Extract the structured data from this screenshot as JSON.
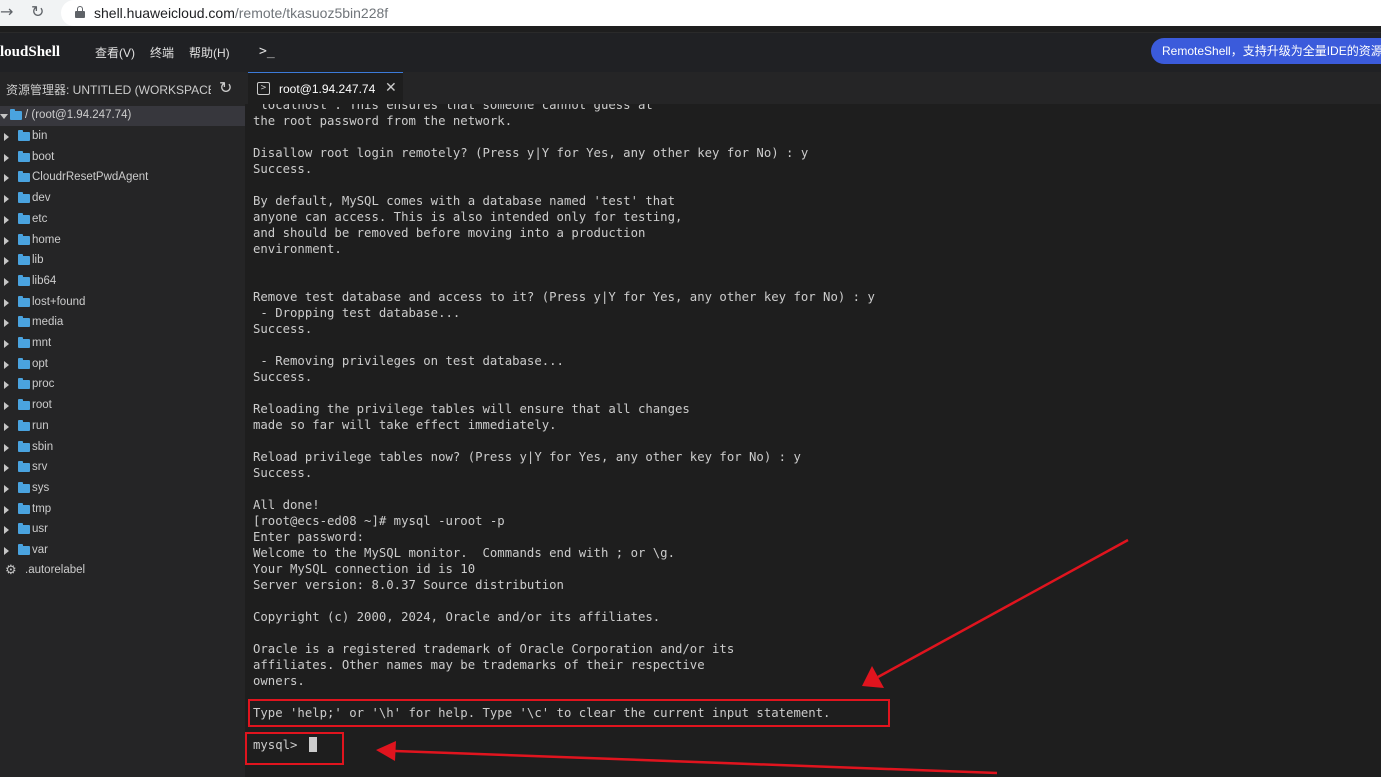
{
  "browser": {
    "url_host": "shell.huaweicloud.com",
    "url_path": "/remote/tkasuoz5bin228f"
  },
  "app": {
    "title": "loudShell",
    "menu": [
      "查看(V)",
      "终端",
      "帮助(H)"
    ],
    "promo_text": "RemoteShell，支持升级为全量IDE的资源管理"
  },
  "sidebar": {
    "title": "资源管理器: UNTITLED (WORKSPACE)",
    "root_label": "/ (root@1.94.247.74)",
    "folders": [
      "bin",
      "boot",
      "CloudrResetPwdAgent",
      "dev",
      "etc",
      "home",
      "lib",
      "lib64",
      "lost+found",
      "media",
      "mnt",
      "opt",
      "proc",
      "root",
      "run",
      "sbin",
      "srv",
      "sys",
      "tmp",
      "usr",
      "var"
    ],
    "file": ".autorelabel"
  },
  "tab": {
    "label": "root@1.94.247.74"
  },
  "terminal": {
    "lines": [
      "'localhost'. This ensures that someone cannot guess at",
      "the root password from the network.",
      "",
      "Disallow root login remotely? (Press y|Y for Yes, any other key for No) : y",
      "Success.",
      "",
      "By default, MySQL comes with a database named 'test' that",
      "anyone can access. This is also intended only for testing,",
      "and should be removed before moving into a production",
      "environment.",
      "",
      "",
      "Remove test database and access to it? (Press y|Y for Yes, any other key for No) : y",
      " - Dropping test database...",
      "Success.",
      "",
      " - Removing privileges on test database...",
      "Success.",
      "",
      "Reloading the privilege tables will ensure that all changes",
      "made so far will take effect immediately.",
      "",
      "Reload privilege tables now? (Press y|Y for Yes, any other key for No) : y",
      "Success.",
      "",
      "All done!",
      "[root@ecs-ed08 ~]# mysql -uroot -p",
      "Enter password:",
      "Welcome to the MySQL monitor.  Commands end with ; or \\g.",
      "Your MySQL connection id is 10",
      "Server version: 8.0.37 Source distribution",
      "",
      "Copyright (c) 2000, 2024, Oracle and/or its affiliates.",
      "",
      "Oracle is a registered trademark of Oracle Corporation and/or its",
      "affiliates. Other names may be trademarks of their respective",
      "owners.",
      "",
      "Type 'help;' or '\\h' for help. Type '\\c' to clear the current input statement.",
      "",
      "mysql> "
    ]
  },
  "annotations": {
    "color": "#e0141e"
  }
}
